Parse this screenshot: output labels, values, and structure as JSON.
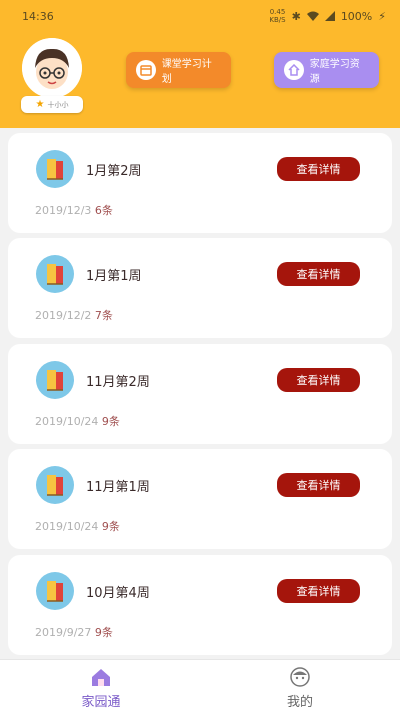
{
  "status_bar": {
    "time": "14:36",
    "speed_value": "0.45",
    "speed_unit": "KB/S",
    "battery": "100%"
  },
  "profile": {
    "badge_label": "十小小"
  },
  "top_buttons": {
    "plan_label": "课堂学习计划",
    "home_label": "家庭学习资源"
  },
  "weeks": [
    {
      "title": "1月第2周",
      "date": "2019/12/3",
      "count": "6条",
      "action": "查看详情"
    },
    {
      "title": "1月第1周",
      "date": "2019/12/2",
      "count": "7条",
      "action": "查看详情"
    },
    {
      "title": "11月第2周",
      "date": "2019/10/24",
      "count": "9条",
      "action": "查看详情"
    },
    {
      "title": "11月第1周",
      "date": "2019/10/24",
      "count": "9条",
      "action": "查看详情"
    },
    {
      "title": "10月第4周",
      "date": "2019/9/27",
      "count": "9条",
      "action": "查看详情"
    }
  ],
  "tabs": {
    "home_label": "家园通",
    "mine_label": "我的"
  },
  "colors": {
    "header": "#fdb92c",
    "accent": "#a5150c",
    "plan_button": "#f38a2a",
    "home_button": "#a98ef0",
    "tab_active": "#7a5ac8"
  }
}
